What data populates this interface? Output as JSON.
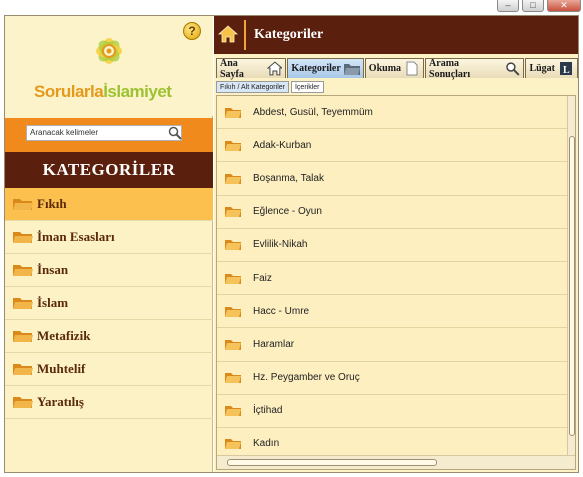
{
  "window": {
    "controls": [
      "–",
      "□",
      "✕"
    ]
  },
  "sidebar": {
    "logo": {
      "part1": "Sorularla",
      "part2": "İslamiyet"
    },
    "help_label": "?",
    "search": {
      "placeholder": "Aranacak kelimeler",
      "value": "Aranacak kelimeler"
    },
    "header": "KATEGORİLER",
    "items": [
      {
        "label": "Fıkıh",
        "active": true
      },
      {
        "label": "İman Esasları",
        "active": false
      },
      {
        "label": "İnsan",
        "active": false
      },
      {
        "label": "İslam",
        "active": false
      },
      {
        "label": "Metafizik",
        "active": false
      },
      {
        "label": "Muhtelif",
        "active": false
      },
      {
        "label": "Yaratılış",
        "active": false
      }
    ]
  },
  "main": {
    "title": "Kategoriler",
    "tabs": [
      {
        "label": "Ana Sayfa",
        "icon": "home-icon"
      },
      {
        "label": "Kategoriler",
        "icon": "folder-icon"
      },
      {
        "label": "Okuma",
        "icon": "document-icon"
      },
      {
        "label": "Arama Sonuçları",
        "icon": "search-icon"
      },
      {
        "label": "Lügat",
        "icon": "dictionary-icon"
      }
    ],
    "subtabs": [
      {
        "label": "Fıkıh / Alt Kategoriler"
      },
      {
        "label": "İçerikler"
      }
    ],
    "rows": [
      "Abdest, Gusül, Teyemmüm",
      "Adak-Kurban",
      "Boşanma, Talak",
      "Eğlence - Oyun",
      "Evlilik-Nikah",
      "Faiz",
      "Hacc - Umre",
      "Haramlar",
      "Hz. Peygamber ve Oruç",
      "İçtihad",
      "Kadın"
    ]
  },
  "colors": {
    "brown": "#5a200d",
    "orange": "#f08a1d",
    "cream": "#fdf1c6",
    "active_item": "#fbc04e"
  }
}
